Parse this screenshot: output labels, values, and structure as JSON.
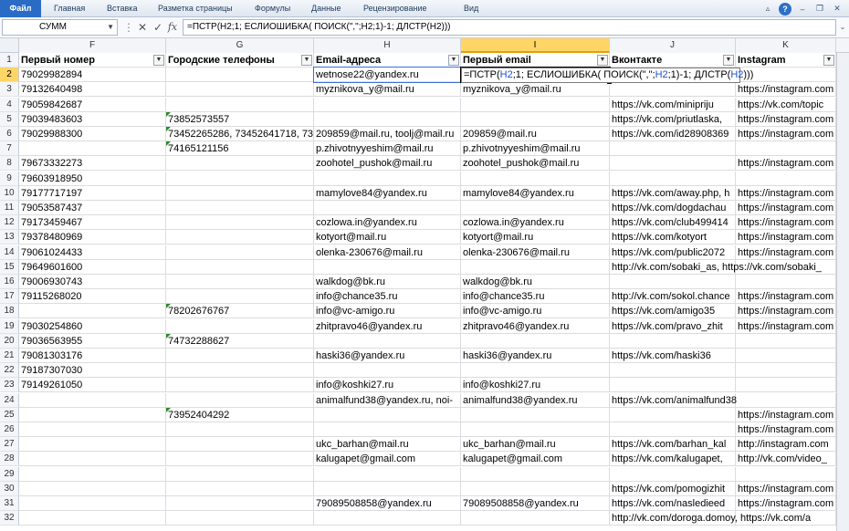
{
  "ribbon": {
    "tabs": [
      "Файл",
      "Главная",
      "Вставка",
      "Разметка страницы",
      "Формулы",
      "Данные",
      "Рецензирование",
      "Вид"
    ]
  },
  "formula_bar": {
    "name_box": "СУММ",
    "cancel": "✕",
    "enter": "✓",
    "fx": "fx",
    "formula": "=ПСТР(H2;1; ЕСЛИОШИБКА( ПОИСК(\",\";H2;1)-1; ДЛСТР(H2)))"
  },
  "columns": [
    "F",
    "G",
    "H",
    "I",
    "J",
    "K"
  ],
  "headers": {
    "F": "Первый номер",
    "G": "Городские телефоны",
    "H": "Email-адреса",
    "I": "Первый email",
    "J": "Вконтакте",
    "K": "Instagram"
  },
  "edit": {
    "cell": "I2",
    "parts": [
      "=ПСТР(",
      "H2",
      ";1; ЕСЛИОШИБКА( ПОИСК(\",\";",
      "H2",
      ";1)-1; ДЛСТР(",
      "H2",
      ")))"
    ]
  },
  "link_text": {
    "instagram_com": "https://instagram.com",
    "instagram_com_http": "http://instagram.com",
    "vk_com": "https://vk.com/"
  },
  "rows": [
    {
      "n": "1"
    },
    {
      "n": "2",
      "F": "79029982894",
      "H": "wetnose22@yandex.ru"
    },
    {
      "n": "3",
      "F": "79132640498",
      "H": "myznikova_y@mail.ru",
      "I": "myznikova_y@mail.ru",
      "K": "https://instagram.com"
    },
    {
      "n": "4",
      "F": "79059842687",
      "J": "https://vk.com/minipriju",
      "K": "https://vk.com/topic"
    },
    {
      "n": "5",
      "F": "79039483603",
      "G": "73852573557",
      "J": "https://vk.com/priutlaska,",
      "K": "https://instagram.com"
    },
    {
      "n": "6",
      "F": "79029988300",
      "G": "73452265286, 73452641718, 7385",
      "H": "209859@mail.ru, toolj@mail.ru",
      "I": "209859@mail.ru",
      "J": "https://vk.com/id28908369",
      "K": "https://instagram.com"
    },
    {
      "n": "7",
      "G": "74165121156",
      "H": "p.zhivotnyyeshim@mail.ru",
      "I": "p.zhivotnyyeshim@mail.ru"
    },
    {
      "n": "8",
      "F": "79673332273",
      "H": "zoohotel_pushok@mail.ru",
      "I": "zoohotel_pushok@mail.ru",
      "K": "https://instagram.com"
    },
    {
      "n": "9",
      "F": "79603918950"
    },
    {
      "n": "10",
      "F": "79177717197",
      "H": "mamylove84@yandex.ru",
      "I": "mamylove84@yandex.ru",
      "J": "https://vk.com/away.php, h",
      "K": "https://instagram.com"
    },
    {
      "n": "11",
      "F": "79053587437",
      "J": "https://vk.com/dogdachau",
      "K": "https://instagram.com"
    },
    {
      "n": "12",
      "F": "79173459467",
      "H": "cozlowa.in@yandex.ru",
      "I": "cozlowa.in@yandex.ru",
      "J": "https://vk.com/club499414",
      "K": "https://instagram.com"
    },
    {
      "n": "13",
      "F": "79378480969",
      "H": "kotyort@mail.ru",
      "I": "kotyort@mail.ru",
      "J": "https://vk.com/kotyort",
      "K": "https://instagram.com"
    },
    {
      "n": "14",
      "F": "79061024433",
      "H": "olenka-230676@mail.ru",
      "I": "olenka-230676@mail.ru",
      "J": "https://vk.com/public2072",
      "K": "https://instagram.com"
    },
    {
      "n": "15",
      "F": "79649601600",
      "J": "http://vk.com/sobaki_as, https://vk.com/sobaki_"
    },
    {
      "n": "16",
      "F": "79006930743",
      "H": "walkdog@bk.ru",
      "I": "walkdog@bk.ru"
    },
    {
      "n": "17",
      "F": "79115268020",
      "H": "info@chance35.ru",
      "I": "info@chance35.ru",
      "J": "http://vk.com/sokol.chance",
      "K": "https://instagram.com"
    },
    {
      "n": "18",
      "G": "78202676767",
      "H": "info@vc-amigo.ru",
      "I": "info@vc-amigo.ru",
      "J": "https://vk.com/amigo35",
      "K": "https://instagram.com"
    },
    {
      "n": "19",
      "F": "79030254860",
      "H": "zhitpravo46@yandex.ru",
      "I": "zhitpravo46@yandex.ru",
      "J": "https://vk.com/pravo_zhit",
      "K": "https://instagram.com"
    },
    {
      "n": "20",
      "F": "79036563955",
      "G": "74732288627"
    },
    {
      "n": "21",
      "F": "79081303176",
      "H": "haski36@yandex.ru",
      "I": "haski36@yandex.ru",
      "J": "https://vk.com/haski36"
    },
    {
      "n": "22",
      "F": "79187307030"
    },
    {
      "n": "23",
      "F": "79149261050",
      "H": "info@koshki27.ru",
      "I": "info@koshki27.ru"
    },
    {
      "n": "24",
      "H": "animalfund38@yandex.ru, noi-",
      "I": "animalfund38@yandex.ru",
      "J": "https://vk.com/animalfund38"
    },
    {
      "n": "25",
      "G": "73952404292",
      "K": "https://instagram.com"
    },
    {
      "n": "26",
      "K": "https://instagram.com"
    },
    {
      "n": "27",
      "H": "ukc_barhan@mail.ru",
      "I": "ukc_barhan@mail.ru",
      "J": "https://vk.com/barhan_kal",
      "K": "http://instagram.com"
    },
    {
      "n": "28",
      "H": "kalugapet@gmail.com",
      "I": "kalugapet@gmail.com",
      "J": "https://vk.com/kalugapet,",
      "K": "http://vk.com/video_"
    },
    {
      "n": "29"
    },
    {
      "n": "30",
      "J": "https://vk.com/pomogizhit",
      "K": "https://instagram.com"
    },
    {
      "n": "31",
      "H": "79089508858@yandex.ru",
      "I": "79089508858@yandex.ru",
      "J": "https://vk.com/nasledieed",
      "K": "https://instagram.com"
    },
    {
      "n": "32",
      "J": "http://vk.com/doroga.domoy, https://vk.com/a"
    }
  ]
}
